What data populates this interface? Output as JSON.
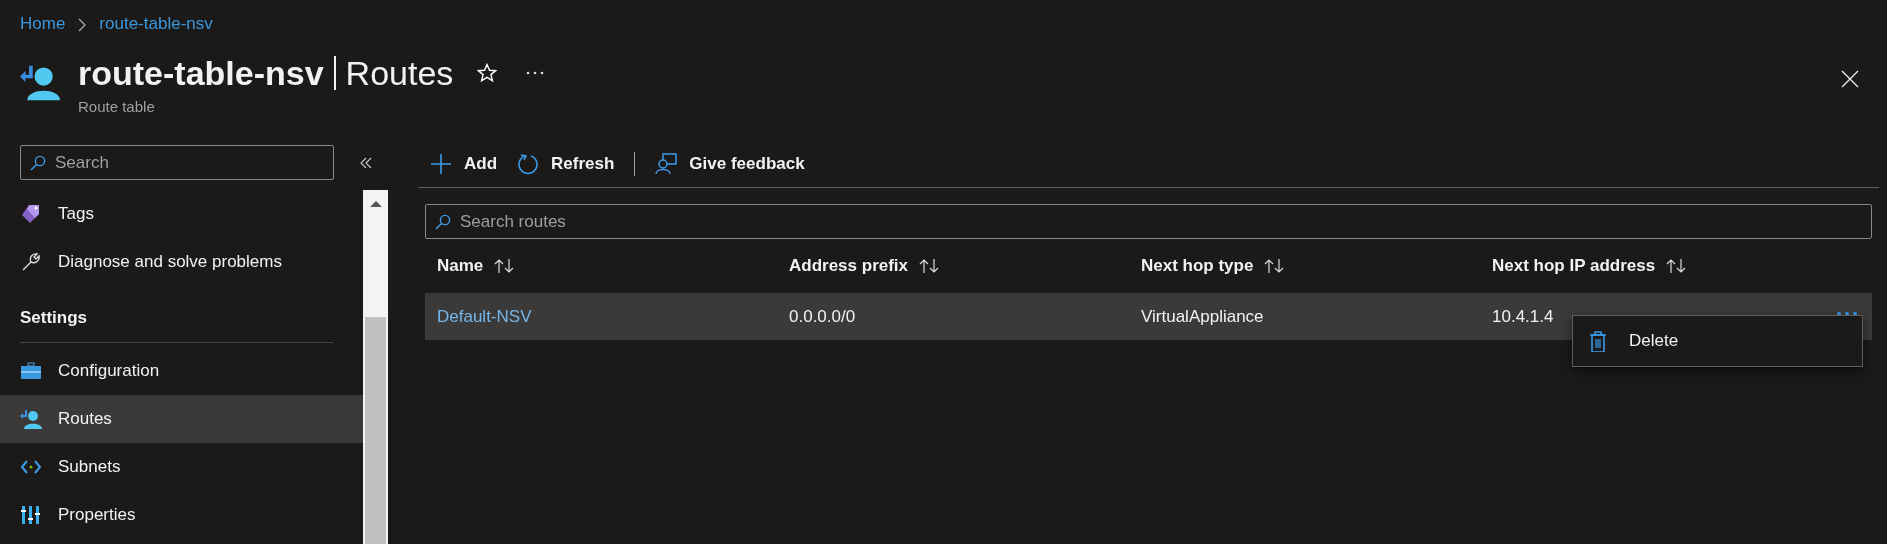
{
  "breadcrumb": [
    "Home",
    "route-table-nsv"
  ],
  "header": {
    "title": "route-table-nsv",
    "section": "Routes",
    "subtitle": "Route table"
  },
  "sidebar": {
    "search": {
      "placeholder": "Search"
    },
    "items": [
      {
        "kind": "item",
        "label": "Tags",
        "selected": false
      },
      {
        "kind": "item",
        "label": "Diagnose and solve problems",
        "selected": false
      },
      {
        "kind": "heading",
        "label": "Settings"
      },
      {
        "kind": "item",
        "label": "Configuration",
        "selected": false
      },
      {
        "kind": "item",
        "label": "Routes",
        "selected": true
      },
      {
        "kind": "item",
        "label": "Subnets",
        "selected": false
      },
      {
        "kind": "item",
        "label": "Properties",
        "selected": false
      }
    ]
  },
  "toolbar": [
    {
      "label": "Add"
    },
    {
      "label": "Refresh"
    },
    {
      "label": "Give feedback"
    }
  ],
  "search": {
    "placeholder": "Search routes"
  },
  "table": {
    "columns": [
      "Name",
      "Address prefix",
      "Next hop type",
      "Next hop IP address"
    ],
    "rows": [
      {
        "selected": true,
        "cells": [
          "Default-NSV",
          "0.0.0.0/0",
          "VirtualAppliance",
          "10.4.1.4"
        ]
      }
    ]
  },
  "context_menu": [
    {
      "label": "Delete"
    }
  ]
}
